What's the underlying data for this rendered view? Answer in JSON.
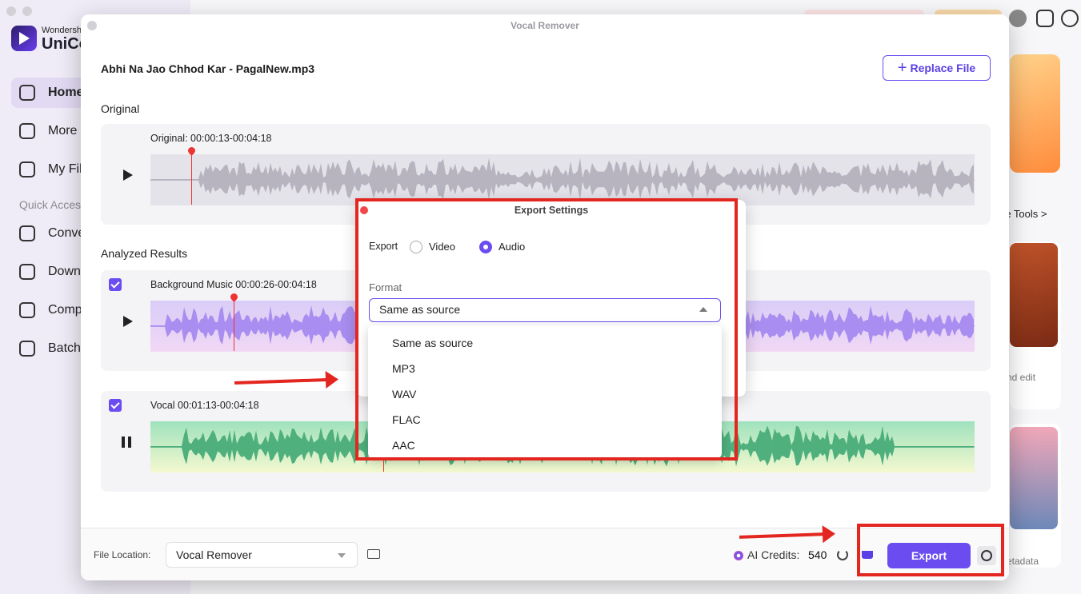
{
  "app": {
    "brand_small": "Wondersh",
    "brand_big": "UniCo",
    "nav": [
      {
        "label": "Home",
        "icon": "home-icon",
        "active": true
      },
      {
        "label": "More T",
        "icon": "toolbox-icon"
      },
      {
        "label": "My Fil",
        "icon": "file-icon"
      }
    ],
    "quick_access_label": "Quick Acces",
    "quick_items": [
      {
        "label": "Conve",
        "icon": "convert-icon"
      },
      {
        "label": "Downl",
        "icon": "download-icon"
      },
      {
        "label": "Comp",
        "icon": "compress-icon"
      },
      {
        "label": "Batch",
        "icon": "batch-icon"
      }
    ],
    "more_tools_link": "re Tools >",
    "side_text_1": "nd edit",
    "side_text_2": "etadata"
  },
  "modal": {
    "title": "Vocal Remover",
    "file_name": "Abhi Na Jao Chhod Kar - PagalNew.mp3",
    "replace_button": "Replace File",
    "original_section": "Original",
    "original_track": {
      "label": "Original: 00:00:13-00:04:18",
      "color": "#b7b4c0"
    },
    "analyzed_section": "Analyzed Results",
    "bg_track": {
      "label": "Background Music 00:00:26-00:04:18",
      "color": "#a98df0",
      "checked": true
    },
    "vocal_track": {
      "label": "Vocal  00:01:13-00:04:18",
      "color": "#4fb07e",
      "checked": true
    },
    "footer": {
      "file_location_label": "File Location:",
      "file_location_value": "Vocal Remover",
      "credits_label": "AI Credits:",
      "credits_value": "540",
      "export_button": "Export"
    }
  },
  "export_settings": {
    "title": "Export Settings",
    "export_label": "Export",
    "options": [
      {
        "label": "Video",
        "selected": false
      },
      {
        "label": "Audio",
        "selected": true
      }
    ],
    "format_label": "Format",
    "format_value": "Same as source",
    "format_options": [
      "Same as source",
      "MP3",
      "WAV",
      "FLAC",
      "AAC"
    ]
  },
  "accent_color": "#6b4cf0",
  "annotation_color": "#e3261f"
}
